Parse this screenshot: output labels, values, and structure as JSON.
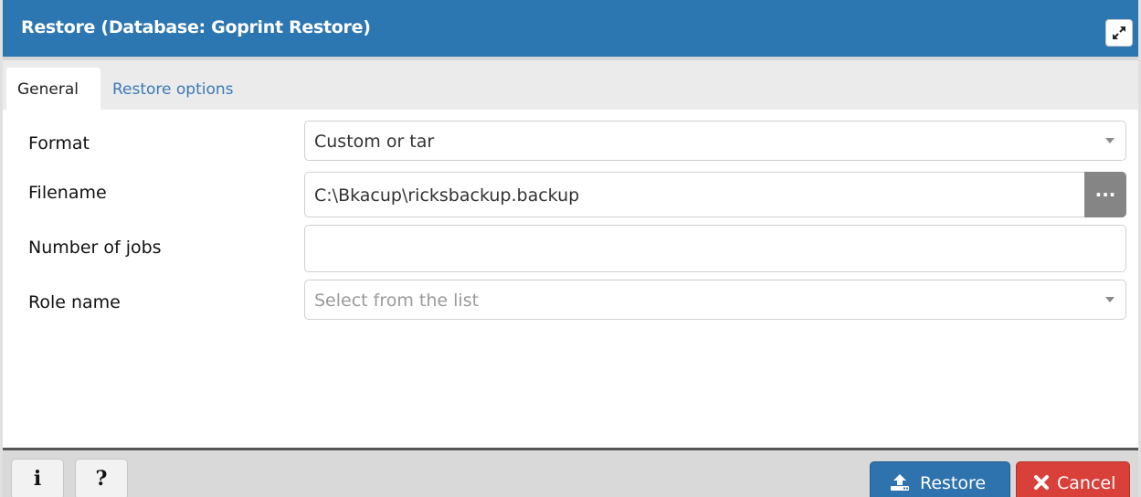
{
  "dialog": {
    "title": "Restore (Database: Goprint Restore)",
    "maximize_icon": "expand-icon"
  },
  "tabs": [
    {
      "label": "General",
      "active": true
    },
    {
      "label": "Restore options",
      "active": false
    }
  ],
  "form": {
    "format": {
      "label": "Format",
      "value": "Custom or tar"
    },
    "filename": {
      "label": "Filename",
      "value": "C:\\Bkacup\\ricksbackup.backup",
      "browse_label": "..."
    },
    "jobs": {
      "label": "Number of jobs",
      "value": ""
    },
    "role": {
      "label": "Role name",
      "placeholder": "Select from the list"
    }
  },
  "footer": {
    "info_label": "i",
    "help_label": "?",
    "restore_label": "Restore",
    "cancel_label": "Cancel"
  },
  "colors": {
    "titlebar": "#2c76b2",
    "restore_button": "#2e73ae",
    "cancel_button": "#d9403a",
    "tab_link": "#3a79b5"
  }
}
